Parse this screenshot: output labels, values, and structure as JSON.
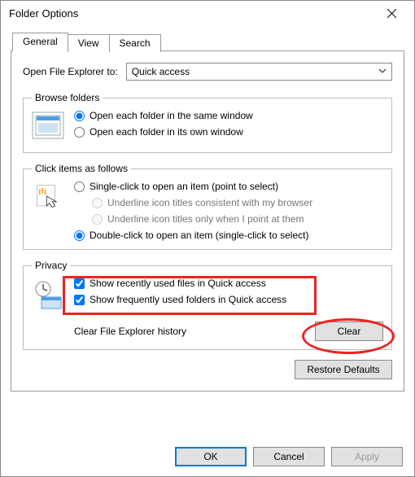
{
  "window": {
    "title": "Folder Options"
  },
  "tabs": {
    "general": "General",
    "view": "View",
    "search": "Search"
  },
  "open_explorer": {
    "label": "Open File Explorer to:",
    "value": "Quick access"
  },
  "groups": {
    "browse": {
      "legend": "Browse folders",
      "opt_same": "Open each folder in the same window",
      "opt_own": "Open each folder in its own window"
    },
    "click": {
      "legend": "Click items as follows",
      "opt_single": "Single-click to open an item (point to select)",
      "sub_browser": "Underline icon titles consistent with my browser",
      "sub_hover": "Underline icon titles only when I point at them",
      "opt_double": "Double-click to open an item (single-click to select)"
    },
    "privacy": {
      "legend": "Privacy",
      "chk_recent": "Show recently used files in Quick access",
      "chk_frequent": "Show frequently used folders in Quick access",
      "clear_label": "Clear File Explorer history",
      "clear_btn": "Clear"
    }
  },
  "buttons": {
    "restore": "Restore Defaults",
    "ok": "OK",
    "cancel": "Cancel",
    "apply": "Apply"
  }
}
